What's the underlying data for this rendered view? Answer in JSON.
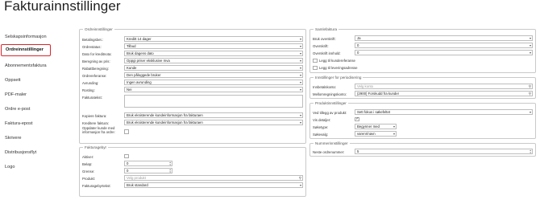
{
  "page_title": "Fakturainnstillinger",
  "sidebar": {
    "items": [
      {
        "label": "Selskapsinformasjon"
      },
      {
        "label": "Ordreinnstillinger",
        "active": true
      },
      {
        "label": "Abonnementsfaktura"
      },
      {
        "label": "Oppsett"
      },
      {
        "label": "PDF-maler"
      },
      {
        "label": "Ordre e-post"
      },
      {
        "label": "Faktura-epost"
      },
      {
        "label": "Skrivere"
      },
      {
        "label": "Distribusjonsflyt"
      },
      {
        "label": "Logo"
      }
    ]
  },
  "ordre": {
    "legend": "Ordreinnstillinger",
    "betalingsbet": {
      "label": "Betalingsbet.:",
      "value": "Kreditt 14 dager"
    },
    "ordrestatus": {
      "label": "Ordrestatus:",
      "value": "Tilbud"
    },
    "dato_kreditnota": {
      "label": "Dato for kreditnota:",
      "value": "Bruk dagens dato"
    },
    "beregning_pris": {
      "label": "Beregning av pris:",
      "value": "Oppgi priser eksklusive mva"
    },
    "rabattberegning": {
      "label": "Rabattberegning:",
      "value": "Kunde"
    },
    "ordrereferanse": {
      "label": "Ordrereferanse:",
      "value": "Den påloggede bruker"
    },
    "avrunding": {
      "label": "Avrunding:",
      "value": "Ingen avrunding"
    },
    "rosting": {
      "label": "Rosting:",
      "value": "Nei"
    },
    "fakturatekst": {
      "label": "Fakturatekst:"
    },
    "kopiere_faktura": {
      "label": "Kopiere faktura:",
      "value": "Bruk eksisterende kundeinformasjon fra fakturaen"
    },
    "kreditere_faktura": {
      "label": "Kreditere faktura:",
      "value": "Bruk eksisterende kundeinformasjon fra fakturaen"
    },
    "oppdater_kunde": {
      "label": "Oppdater kunde med informasjon fra ordre:",
      "checked": false
    }
  },
  "fakturagebyr": {
    "legend": "Fakturagebyr",
    "aktiver": {
      "label": "Aktiver:",
      "checked": false
    },
    "belop": {
      "label": "Beløp:",
      "value": "0"
    },
    "grense": {
      "label": "Grense:",
      "value": "0"
    },
    "produkt": {
      "label": "Produkt:",
      "placeholder": "Velg produkt"
    },
    "fakturagebyrtekst": {
      "label": "Fakturagebyrtekst:",
      "value": "Bruk standard"
    }
  },
  "samlefaktura": {
    "legend": "Samlefaktura",
    "bruk_overskrift": {
      "label": "Bruk overskrift:",
      "value": "Ja"
    },
    "overskrift": {
      "label": "Overskrift:",
      "value": "0"
    },
    "overskrift_innhold": {
      "label": "Overskrift innhold:",
      "value": "0"
    },
    "legg_til_kundereferanse": {
      "label": "Legg til kundereferanse",
      "checked": false
    },
    "legg_til_leveringsadresse": {
      "label": "Legg til leveringsadresse",
      "checked": false
    }
  },
  "periodisering": {
    "legend": "Innstillinger for periodisering",
    "innbetalskonto": {
      "label": "Innbetalskonto:",
      "placeholder": "Velg konto"
    },
    "mellomregningskonto": {
      "label": "Mellomregningskonto:",
      "value": "(2900) Forskudd fra kunder"
    }
  },
  "produkt": {
    "legend": "Produktinnstillinger",
    "ved_tillegg": {
      "label": "Ved tillegg av produkt:",
      "value": "Sett fokus i søkefeltet"
    },
    "vis_detaljer": {
      "label": "Vis detaljer:",
      "checked": true
    },
    "sokeetype": {
      "label": "Søketype:",
      "value": "Begynner med"
    },
    "sokevalg": {
      "label": "Søkevalg:",
      "value": "varenr/navn"
    }
  },
  "nummer": {
    "legend": "Nummerinnstillinger",
    "neste_ordrenummer": {
      "label": "Neste ordrenummer:",
      "value": "5"
    }
  },
  "icons": {
    "caret": "▾",
    "search": "⚲",
    "check": "✓",
    "stepper_up": "▴",
    "stepper_down": "▾"
  }
}
